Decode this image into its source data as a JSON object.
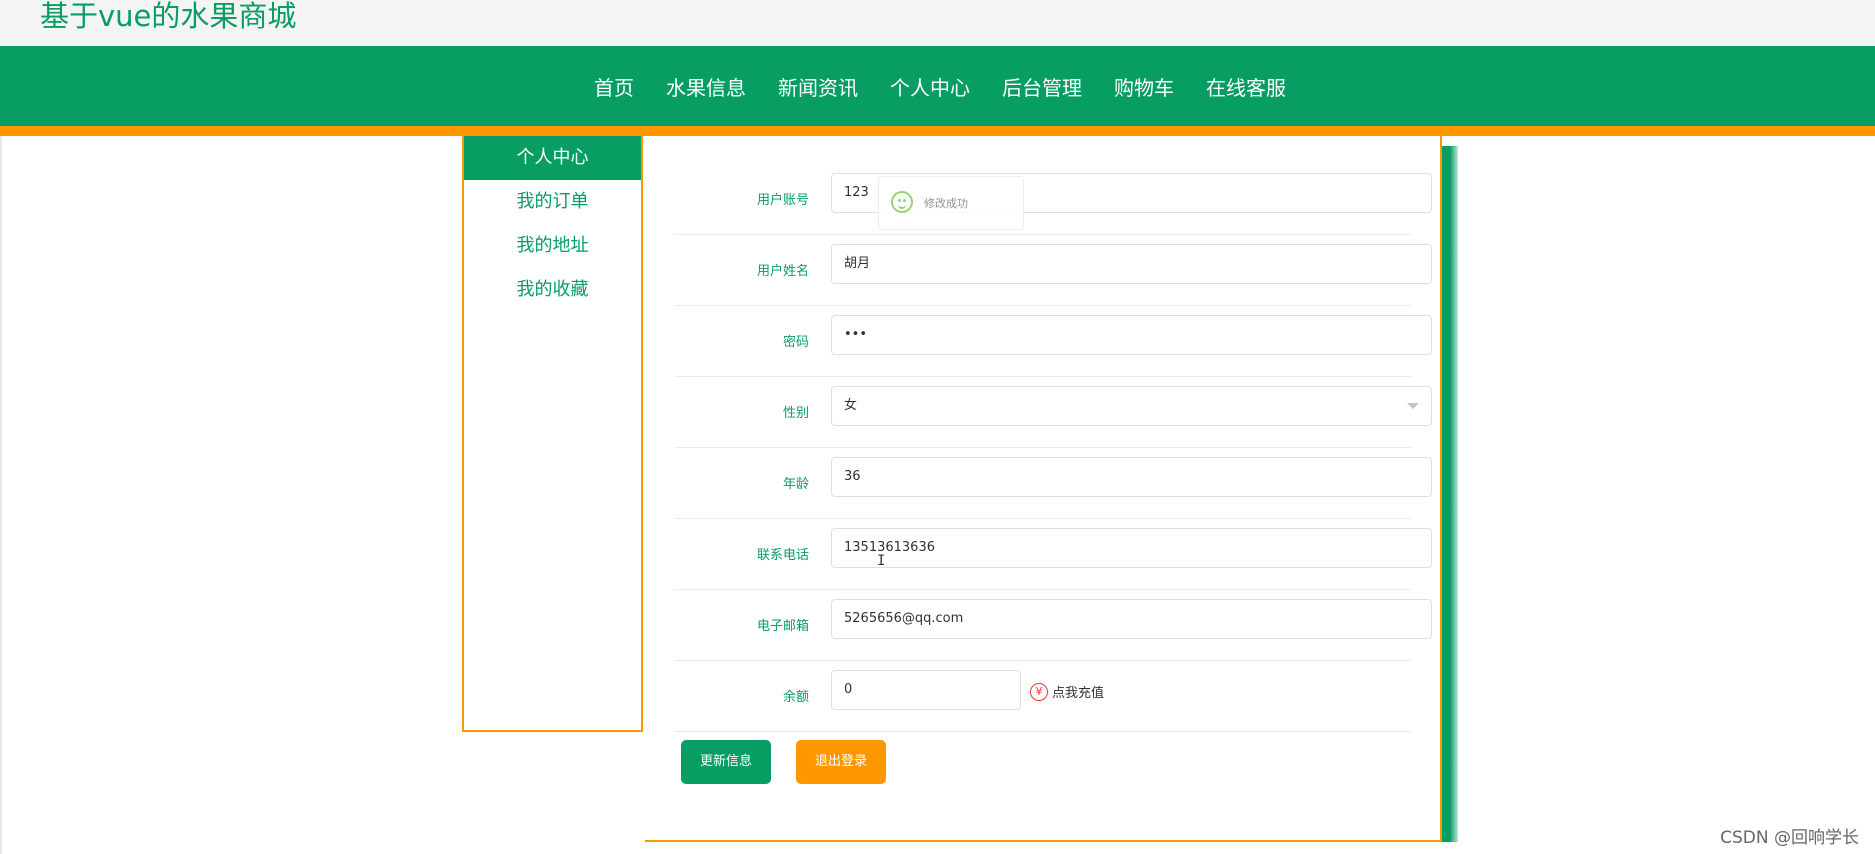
{
  "site": {
    "title": "基于vue的水果商城"
  },
  "nav": {
    "items": [
      "首页",
      "水果信息",
      "新闻资讯",
      "个人中心",
      "后台管理",
      "购物车",
      "在线客服"
    ]
  },
  "sidebar": {
    "items": [
      {
        "label": "个人中心",
        "active": true
      },
      {
        "label": "我的订单",
        "active": false
      },
      {
        "label": "我的地址",
        "active": false
      },
      {
        "label": "我的收藏",
        "active": false
      }
    ]
  },
  "form": {
    "account": {
      "label": "用户账号",
      "value": "123"
    },
    "name": {
      "label": "用户姓名",
      "value": "胡月"
    },
    "password": {
      "label": "密码",
      "value": "•••"
    },
    "gender": {
      "label": "性别",
      "value": "女"
    },
    "age": {
      "label": "年龄",
      "value": "36"
    },
    "phone": {
      "label": "联系电话",
      "value": "13513613636"
    },
    "email": {
      "label": "电子邮箱",
      "value": "5265656@qq.com"
    },
    "balance": {
      "label": "余额",
      "value": "0",
      "recharge_label": "点我充值"
    }
  },
  "buttons": {
    "update": "更新信息",
    "logout": "退出登录"
  },
  "toast": {
    "message": "修改成功"
  },
  "watermark": "CSDN @回响学长",
  "colors": {
    "brand_green": "#079d63",
    "accent_orange": "#ff9800"
  }
}
